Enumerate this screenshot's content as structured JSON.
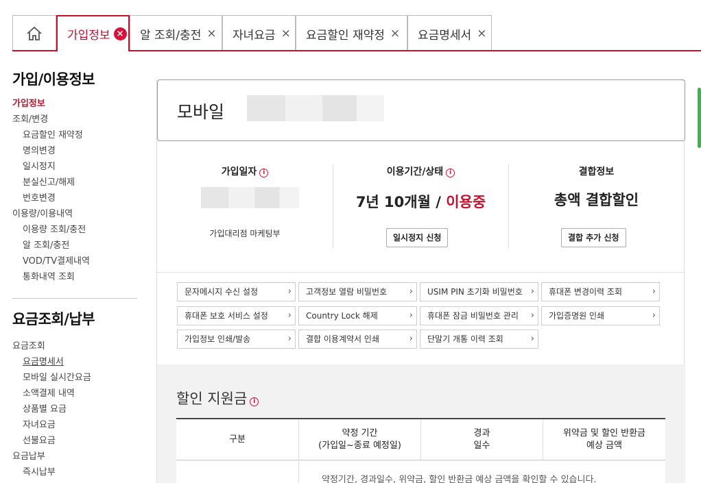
{
  "tabs": [
    {
      "label": "가입정보",
      "active": true
    },
    {
      "label": "알 조회/충전"
    },
    {
      "label": "자녀요금"
    },
    {
      "label": "요금할인 재약정"
    },
    {
      "label": "요금명세서"
    }
  ],
  "close_glyph": "×",
  "sidebar": {
    "section1_title": "가입/이용정보",
    "section1_items": [
      "가입정보",
      "조회/변경",
      "요금할인 재약정",
      "명의변경",
      "일시정지",
      "분실신고/해제",
      "번호변경",
      "이용량/이용내역",
      "이용량 조회/충전",
      "알 조회/충전",
      "VOD/TV결제내역",
      "통화내역 조회"
    ],
    "section2_title": "요금조회/납부",
    "section2_items": [
      "요금조회",
      "요금명세서",
      "모바일 실시간요금",
      "소액결제 내역",
      "상품별 요금",
      "자녀요금",
      "선불요금",
      "요금납부",
      "즉시납부"
    ]
  },
  "main": {
    "title": "모바일",
    "join_date_label": "가입일자",
    "join_agency": "가입대리점 마케팅부",
    "period_label": "이용기간/상태",
    "period_value": "7년 10개월 /",
    "status_value": "이용중",
    "suspend_button": "일시정지 신청",
    "combo_label": "결합정보",
    "combo_value": "총액 결합할인",
    "combo_button": "결합 추가 신청",
    "info_icon": "i",
    "links": [
      "문자메시지 수신 설정",
      "고객정보 열람 비밀번호",
      "USIM PIN 초기화 비밀번호",
      "휴대폰 변경이력 조회",
      "휴대폰 보호 서비스 설정",
      "Country Lock 해제",
      "휴대폰 잠금 비밀번호 관리",
      "가입증명원 인쇄",
      "가입정보 인쇄/발송",
      "결합 이용계약서 인쇄",
      "단말기 개통 이력 조회"
    ],
    "link_chevron": "›",
    "discount_title": "할인 지원금",
    "table_headers": [
      "구분",
      "약정 기간\n(가입일~종료 예정일)",
      "경과\n일수",
      "위약금 및 할인 반환금\n예상 금액"
    ],
    "table_note": "약정기간, 경과일수, 위약금, 할인 반환금 예상 금액을 확인할 수 있습니다."
  },
  "colors": {
    "accent": "#c8102e",
    "border": "#bbbbbb"
  },
  "icons": {
    "home": "home-icon",
    "close": "close-icon",
    "info": "info-icon",
    "chevron": "chevron-right-icon"
  }
}
